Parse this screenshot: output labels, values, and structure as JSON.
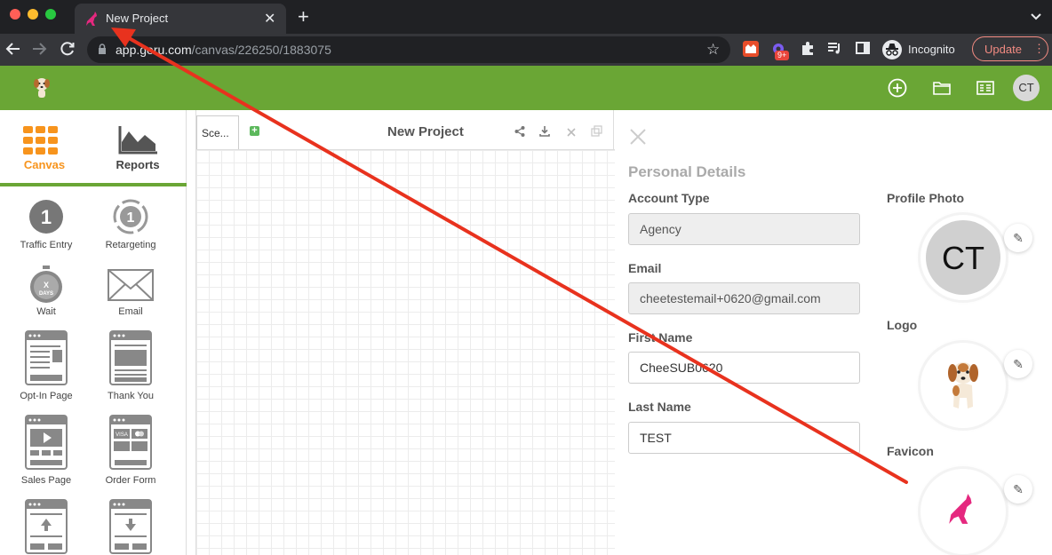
{
  "browser": {
    "tab_title": "New Project",
    "url_domain": "app.",
    "url_domain_rest": "geru.com",
    "url_path": "/canvas/226250/1883075",
    "badge": "9+",
    "incognito_label": "Incognito",
    "update_label": "Update",
    "colors": {
      "close": "#ff5f57",
      "minimize": "#febc2e",
      "maximize": "#28c840"
    }
  },
  "header": {
    "avatar_initials": "CT",
    "accent_color": "#6aa635"
  },
  "sidebar": {
    "tabs": [
      {
        "label": "Canvas",
        "icon": "grid-icon",
        "active": true
      },
      {
        "label": "Reports",
        "icon": "chart-icon",
        "active": false
      }
    ],
    "tools": [
      {
        "label": "Traffic Entry",
        "icon": "number-one-icon"
      },
      {
        "label": "Retargeting",
        "icon": "retarget-icon"
      },
      {
        "label": "Wait",
        "icon": "stopwatch-icon",
        "icon_text_top": "X",
        "icon_text_bottom": "DAYS"
      },
      {
        "label": "Email",
        "icon": "envelope-icon"
      },
      {
        "label": "Opt-In Page",
        "icon": "optin-page-icon"
      },
      {
        "label": "Thank You",
        "icon": "thankyou-page-icon"
      },
      {
        "label": "Sales Page",
        "icon": "sales-page-icon"
      },
      {
        "label": "Order Form",
        "icon": "order-form-icon",
        "icon_text": "VISA"
      },
      {
        "label": "",
        "icon": "upsell-page-icon"
      },
      {
        "label": "",
        "icon": "downsell-page-icon"
      }
    ]
  },
  "canvas": {
    "scene_tab": "Sce...",
    "add_scene": "+",
    "project_title": "New Project"
  },
  "panel": {
    "title": "Personal Details",
    "account_type": {
      "label": "Account Type",
      "value": "Agency"
    },
    "email": {
      "label": "Email",
      "value": "cheetestemail+0620@gmail.com"
    },
    "first_name": {
      "label": "First Name",
      "value": "CheeSUB0620"
    },
    "last_name": {
      "label": "Last Name",
      "value": "TEST"
    },
    "profile_photo": {
      "label": "Profile Photo",
      "initials": "CT"
    },
    "logo": {
      "label": "Logo"
    },
    "favicon": {
      "label": "Favicon"
    },
    "edit_glyph": "✎"
  },
  "annotation": {
    "color": "#e8321e"
  }
}
